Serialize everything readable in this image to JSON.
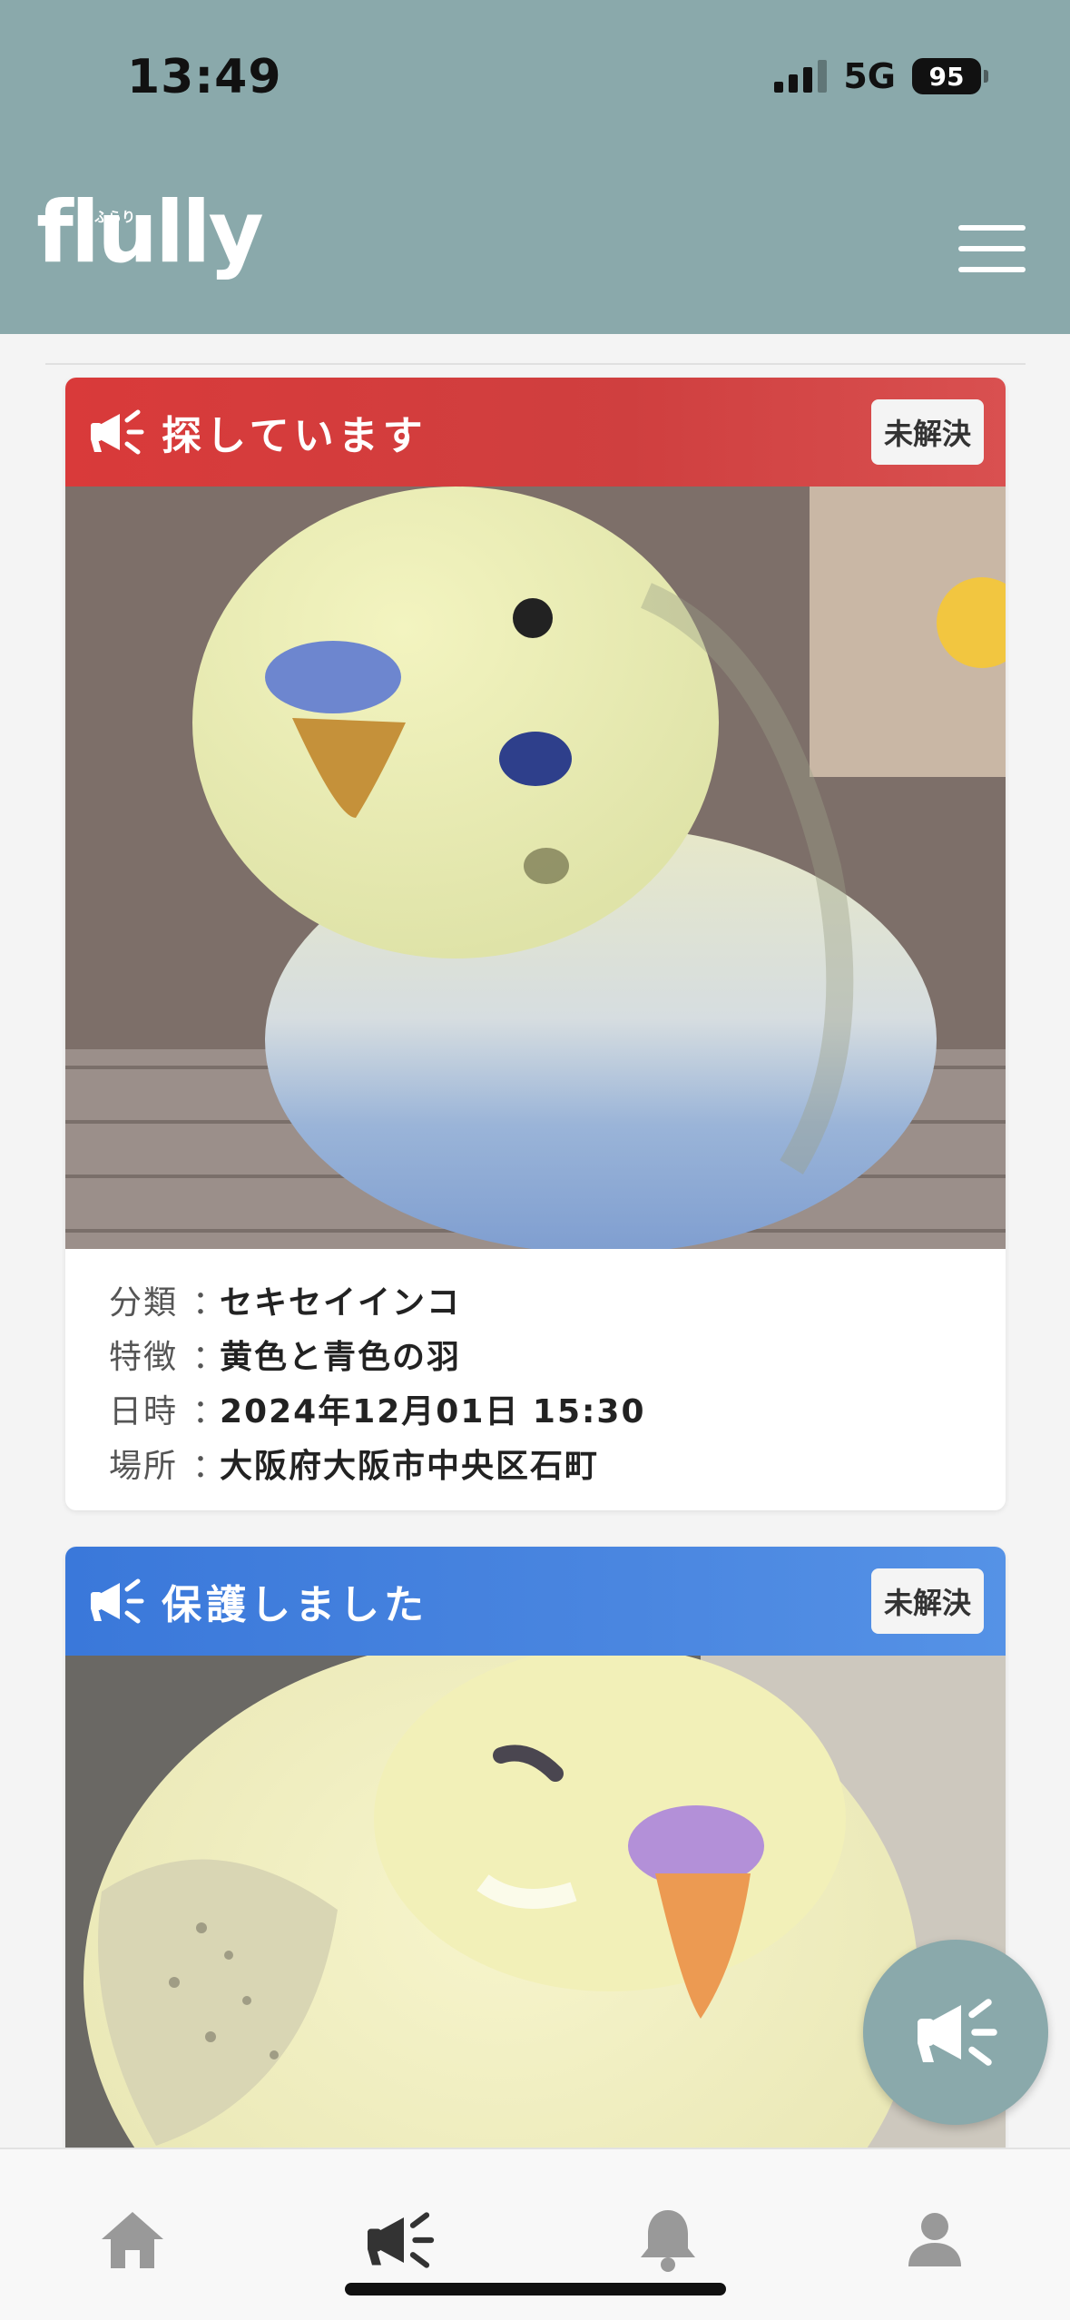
{
  "status_bar": {
    "time": "13:49",
    "network": "5G",
    "battery": "95"
  },
  "header": {
    "logo_text": "flully",
    "logo_sub": "ふらり"
  },
  "cards": [
    {
      "title": "探しています",
      "status": "未解決",
      "accent_color": "#d93a3a",
      "info": [
        {
          "label": "分類",
          "value": "セキセイインコ"
        },
        {
          "label": "特徴",
          "value": "黄色と青色の羽"
        },
        {
          "label": "日時",
          "value": "2024年12月01日 15:30"
        },
        {
          "label": "場所",
          "value": "大阪府大阪市中央区石町"
        }
      ]
    },
    {
      "title": "保護しました",
      "status": "未解決",
      "accent_color": "#3a78da"
    }
  ],
  "colors": {
    "header_bg": "#8aa9ab",
    "found_red": "#d93a3a",
    "protected_blue": "#3a78da"
  },
  "nav": {
    "items": [
      "home-icon",
      "megaphone-icon",
      "bell-icon",
      "user-icon"
    ],
    "active": "megaphone-icon"
  }
}
